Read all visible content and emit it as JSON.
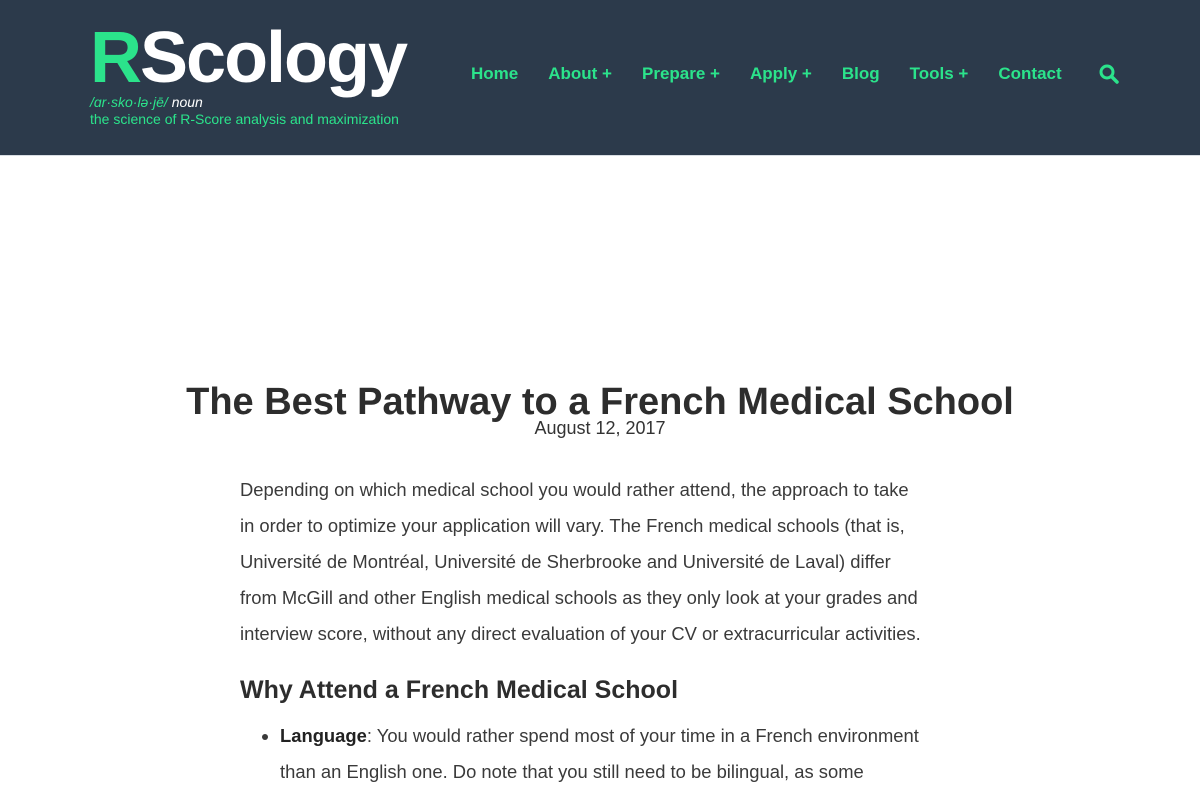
{
  "brand": {
    "logo_first": "R",
    "logo_rest": "Scology",
    "pronunciation": "/ɑr·sko·lə·jē/",
    "part_of_speech": "noun",
    "tagline": "the science of R-Score analysis and maximization",
    "accent_color": "#2be38b",
    "header_bg": "#2c3a4b"
  },
  "nav": {
    "items": [
      {
        "label": "Home"
      },
      {
        "label": "About +"
      },
      {
        "label": "Prepare +"
      },
      {
        "label": "Apply +"
      },
      {
        "label": "Blog"
      },
      {
        "label": "Tools +"
      },
      {
        "label": "Contact"
      }
    ],
    "search_icon": "search-icon"
  },
  "post": {
    "title": "The Best Pathway to a French Medical School",
    "date": "August 12, 2017",
    "intro_lines": [
      "Depending on which medical school you would rather attend, the approach to take",
      "in order to optimize your application will vary. The French medical schools (that is,",
      "Université de Montréal, Université de Sherbrooke and Université de Laval) differ",
      "from McGill and other English medical schools as they only look at your grades and",
      "interview score, without any direct evaluation of your CV or extracurricular activities."
    ],
    "section_heading": "Why Attend a French Medical School",
    "bullets": [
      {
        "term": "Language",
        "lines": [
          ": You would rather spend most of your time in a French environment",
          "than an English one. Do note that you still need to be bilingual, as some"
        ]
      }
    ]
  }
}
